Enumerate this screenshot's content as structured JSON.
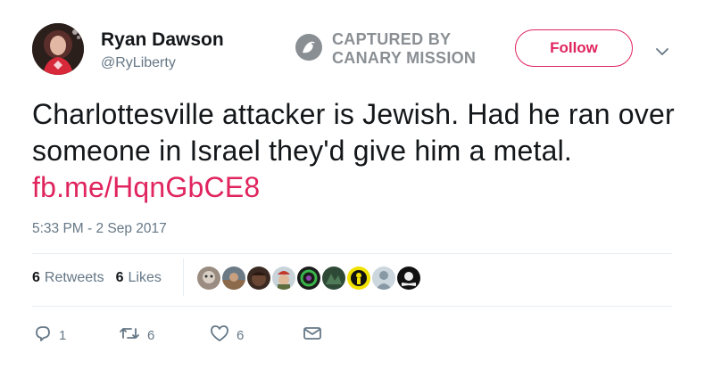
{
  "user": {
    "name": "Ryan Dawson",
    "handle": "@RyLiberty"
  },
  "watermark": {
    "line1": "CAPTURED BY",
    "line2": "CANARY MISSION"
  },
  "follow_label": "Follow",
  "tweet": {
    "text": "Charlottesville attacker is Jewish. Had he ran over someone in Israel they'd give him a metal.",
    "link": "fb.me/HqnGbCE8"
  },
  "timestamp": "5:33 PM - 2 Sep 2017",
  "stats": {
    "retweets_count": "6",
    "retweets_label": "Retweets",
    "likes_count": "6",
    "likes_label": "Likes"
  },
  "actions": {
    "reply_count": "1",
    "retweet_count": "6",
    "like_count": "6"
  },
  "colors": {
    "accent": "#e0245e",
    "secondary_text": "#657786",
    "primary_text": "#14171a",
    "divider": "#e6ecf0"
  },
  "icons": [
    "chevron-down-icon",
    "canary-logo-icon",
    "reply-icon",
    "retweet-icon",
    "like-icon",
    "direct-message-icon"
  ]
}
